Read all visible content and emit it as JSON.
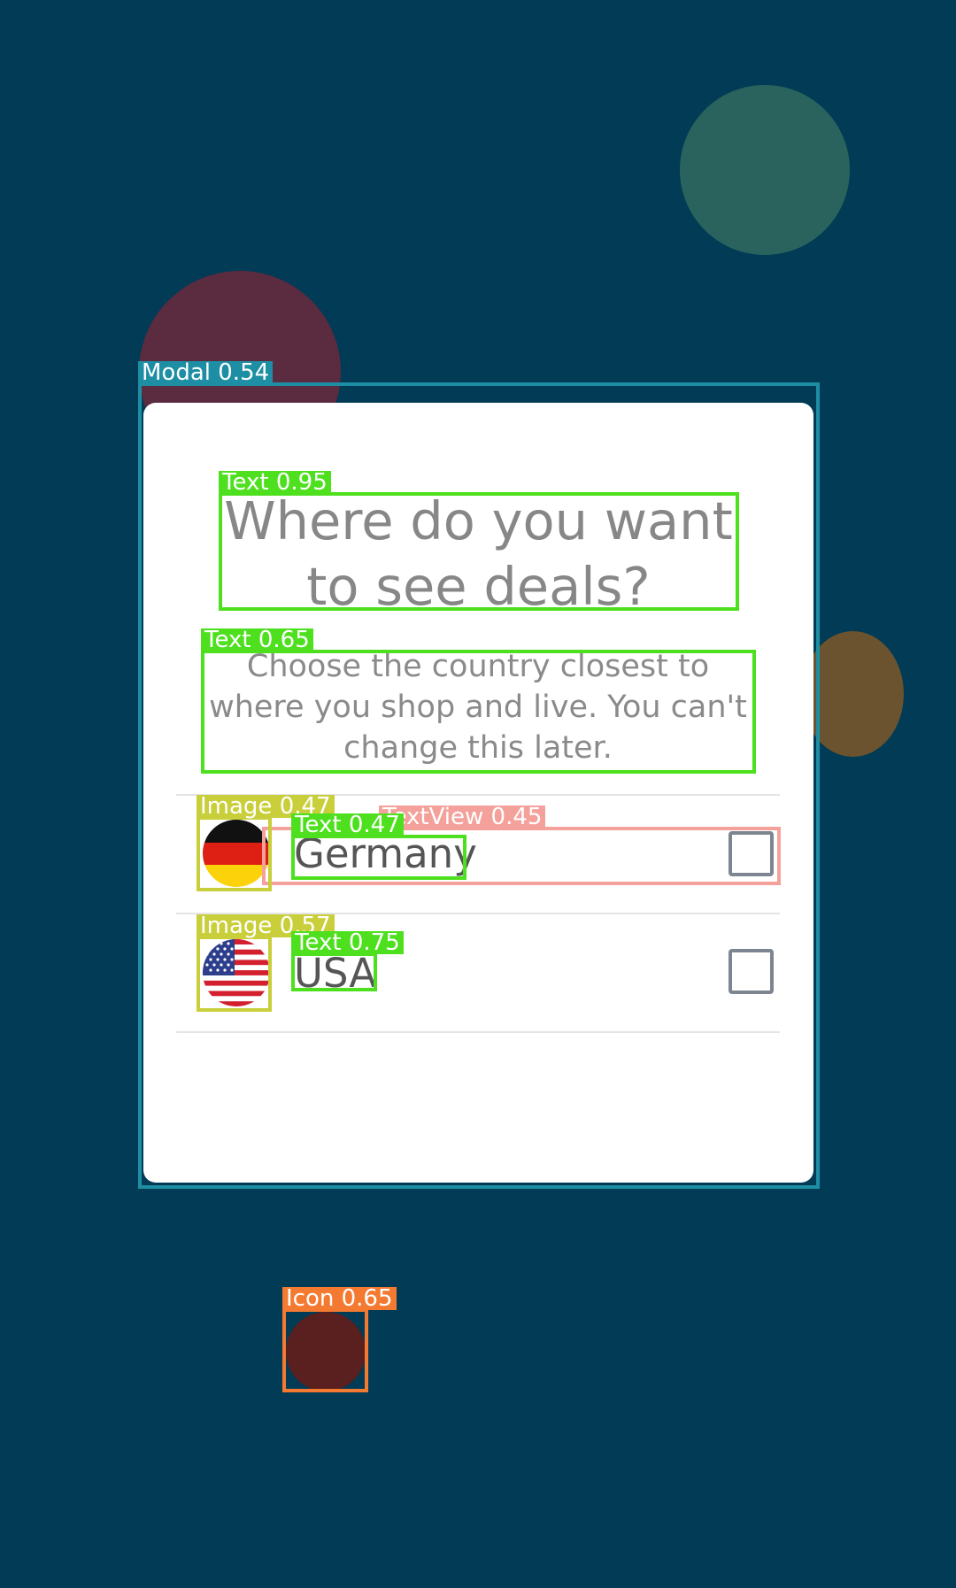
{
  "modal": {
    "title": "Where do you want to see deals?",
    "subtitle": "Choose the country closest to where you shop and live. You can't change this later.",
    "countries": [
      {
        "name": "Germany",
        "flag_icon": "germany-flag-icon",
        "checked": false
      },
      {
        "name": "USA",
        "flag_icon": "usa-flag-icon",
        "checked": false
      }
    ]
  },
  "annotations": {
    "modal": "Modal  0.54",
    "title_text": "Text  0.95",
    "subtitle_text": "Text  0.65",
    "germany_image": "Image  0.47",
    "germany_textview": "TextView  0.45",
    "germany_text": "Text  0.47",
    "usa_image": "Image  0.57",
    "usa_text": "Text  0.75",
    "bottom_icon": "Icon  0.65"
  },
  "colors": {
    "background": "#013b55",
    "modal_bg": "#ffffff",
    "title_text": "#878787",
    "checkbox_border": "#7c8590",
    "ann_text": "#4ee01f",
    "ann_modal": "#1d8ea3",
    "ann_image": "#c9cf3a",
    "ann_textview": "#f4a19b",
    "ann_icon": "#f47a31"
  }
}
